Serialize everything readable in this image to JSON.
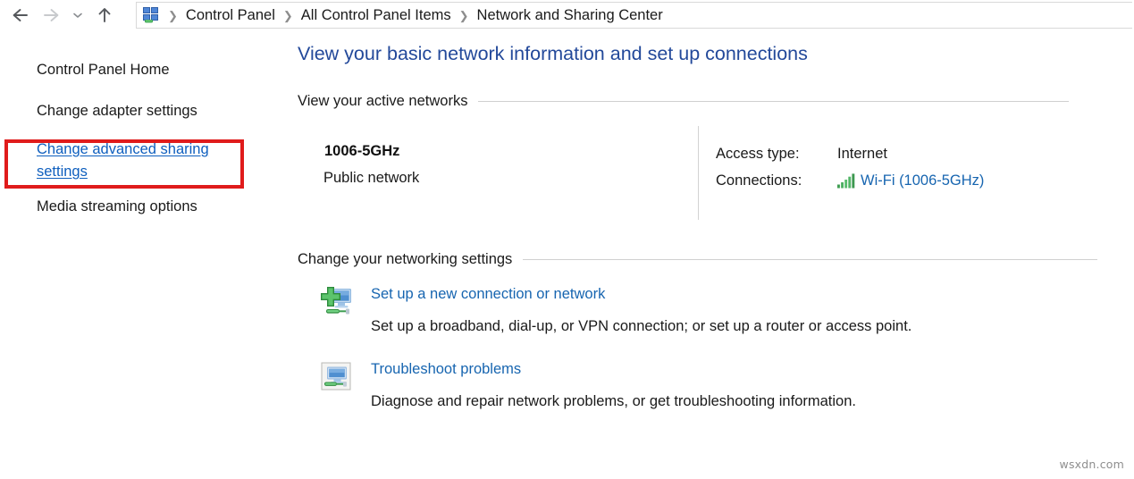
{
  "window": {
    "addressbar": {
      "back_tooltip": "Back",
      "forward_tooltip": "Forward",
      "recent_tooltip": "Recent locations",
      "up_tooltip": "Up",
      "icon": "control-panel-icon",
      "separator": "❯",
      "breadcrumbs": [
        "Control Panel",
        "All Control Panel Items",
        "Network and Sharing Center"
      ]
    }
  },
  "sidebar": {
    "items": [
      {
        "label": "Control Panel Home",
        "state": "normal"
      },
      {
        "label": "Change adapter settings",
        "state": "normal"
      },
      {
        "label": "Change advanced sharing settings",
        "state": "highlighted"
      },
      {
        "label": "Media streaming options",
        "state": "normal"
      }
    ],
    "highlight_color": "#e01b1b"
  },
  "main": {
    "title": "View your basic network information and set up connections",
    "title_color": "#23499a",
    "sections": [
      {
        "heading": "View your active networks"
      },
      {
        "heading": "Change your networking settings"
      }
    ],
    "active_network": {
      "name": "1006-5GHz",
      "type": "Public network",
      "details": [
        {
          "label": "Access type:",
          "value": "Internet",
          "is_link": false
        },
        {
          "label": "Connections:",
          "value": "Wi-Fi (1006-5GHz)",
          "is_link": true,
          "icon": "wifi-signal-icon"
        }
      ]
    },
    "actions": [
      {
        "icon": "new-connection-icon",
        "link": "Set up a new connection or network",
        "description": "Set up a broadband, dial-up, or VPN connection; or set up a router or access point."
      },
      {
        "icon": "troubleshoot-icon",
        "link": "Troubleshoot problems",
        "description": "Diagnose and repair network problems, or get troubleshooting information."
      }
    ],
    "link_color": "#1765b0"
  },
  "watermark": "wsxdn.com"
}
